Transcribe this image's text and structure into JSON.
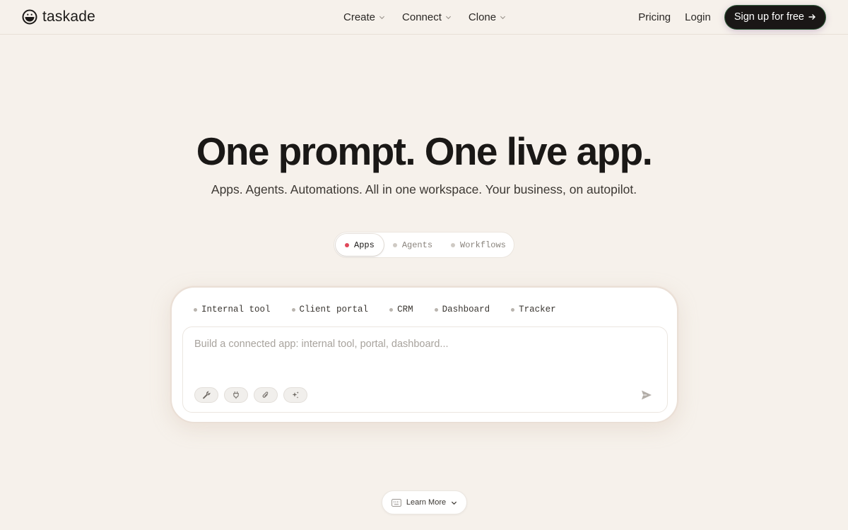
{
  "brand": {
    "name": "taskade"
  },
  "nav": {
    "menus": [
      {
        "label": "Create"
      },
      {
        "label": "Connect"
      },
      {
        "label": "Clone"
      }
    ],
    "pricing": "Pricing",
    "login": "Login",
    "signup": "Sign up for free"
  },
  "hero": {
    "title": "One prompt. One live app.",
    "subtitle": "Apps. Agents. Automations. All in one workspace. Your business, on autopilot."
  },
  "modes": [
    {
      "label": "Apps",
      "active": true
    },
    {
      "label": "Agents",
      "active": false
    },
    {
      "label": "Workflows",
      "active": false
    }
  ],
  "prompt": {
    "chips": [
      "Internal tool",
      "Client portal",
      "CRM",
      "Dashboard",
      "Tracker"
    ],
    "placeholder": "Build a connected app: internal tool, portal, dashboard...",
    "tools": [
      "wrench-icon",
      "plug-icon",
      "paperclip-icon",
      "sparkles-icon"
    ],
    "send_icon": "send-icon"
  },
  "learn_more": {
    "label": "Learn More"
  },
  "colors": {
    "background": "#f6f1eb",
    "active_dot": "#e0475a",
    "signup_bg": "#1a1716"
  }
}
